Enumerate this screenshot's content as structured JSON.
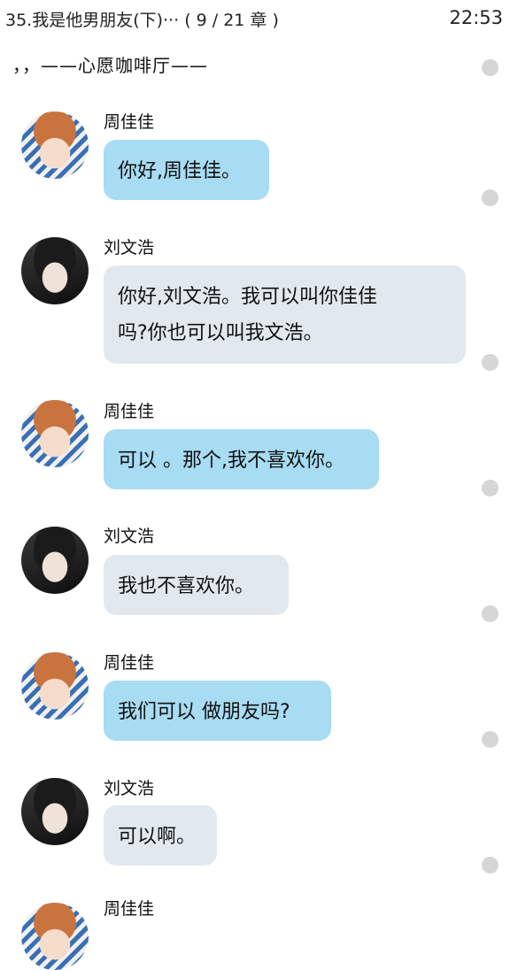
{
  "status_bar": {
    "chapter_title": "35.我是他男朋友(下)··· ( 9 / 21 章 )",
    "time": "22:53"
  },
  "subtitle": "，，——心愿咖啡厅——",
  "messages": [
    {
      "sender": "周佳佳",
      "lines": [
        "你好,周佳佳。"
      ]
    },
    {
      "sender": "刘文浩",
      "lines": [
        "你好,刘文浩。我可以叫你佳佳",
        "吗?你也可以叫我文浩。"
      ]
    },
    {
      "sender": "周佳佳",
      "lines": [
        "可以 。那个,我不喜欢你。"
      ]
    },
    {
      "sender": "刘文浩",
      "lines": [
        "我也不喜欢你。"
      ]
    },
    {
      "sender": "周佳佳",
      "lines": [
        "我们可以 做朋友吗?"
      ]
    },
    {
      "sender": "刘文浩",
      "lines": [
        "可以啊。"
      ]
    },
    {
      "sender": "周佳佳",
      "lines": []
    }
  ],
  "colors": {
    "bubble_zhou": "#a7dcf3",
    "bubble_liu": "#e2e9ee",
    "scroll_dot": "#d6d6d6"
  }
}
